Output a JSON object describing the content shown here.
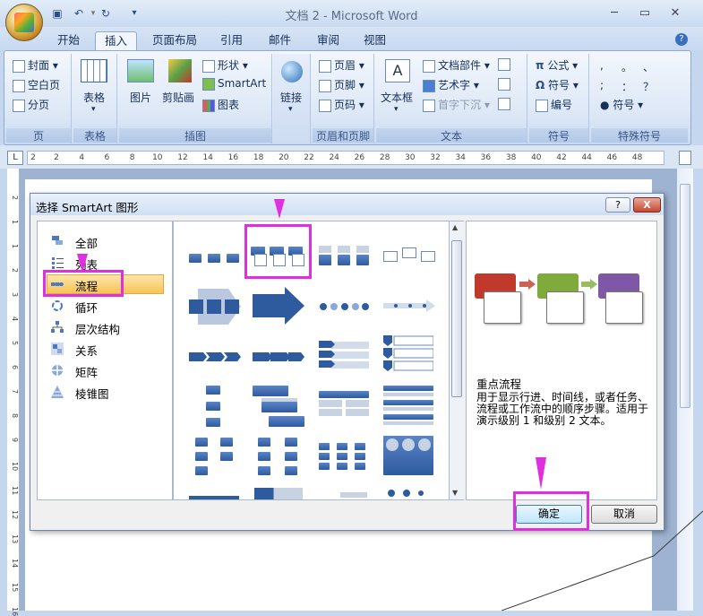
{
  "window": {
    "title": "文档 2 - Microsoft Word"
  },
  "tabs": [
    "开始",
    "插入",
    "页面布局",
    "引用",
    "邮件",
    "审阅",
    "视图"
  ],
  "ribbon": {
    "pages": {
      "label": "页",
      "items": [
        "封面",
        "空白页",
        "分页"
      ]
    },
    "table": {
      "label": "表格",
      "button": "表格"
    },
    "illustrations": {
      "label": "插图",
      "picture": "图片",
      "clipart": "剪贴画",
      "shapes": "形状",
      "smartart": "SmartArt",
      "chart": "图表"
    },
    "links": {
      "button": "链接"
    },
    "header_footer": {
      "label": "页眉和页脚",
      "items": [
        "页眉",
        "页脚",
        "页码"
      ]
    },
    "text": {
      "label": "文本",
      "textbox": "文本框",
      "items": [
        "文档部件",
        "艺术字",
        "首字下沉"
      ]
    },
    "symbols": {
      "label": "符号",
      "items": [
        "公式",
        "符号",
        "编号"
      ]
    },
    "special": {
      "label": "特殊符号",
      "symbol": "符号",
      "chars": [
        ",",
        "。",
        "、",
        ";",
        "：",
        "？"
      ]
    }
  },
  "ruler": {
    "numbers": [
      "2",
      "2",
      "4",
      "6",
      "8",
      "10",
      "12",
      "14",
      "16",
      "18",
      "20",
      "22",
      "24",
      "26",
      "28",
      "30",
      "32",
      "34",
      "36",
      "38",
      "40",
      "42",
      "44",
      "46",
      "48"
    ]
  },
  "vruler": {
    "numbers": [
      "2",
      "1",
      "1",
      "2",
      "3",
      "4",
      "5",
      "6",
      "7",
      "8",
      "9",
      "10",
      "11",
      "12",
      "13",
      "14",
      "15",
      "16"
    ]
  },
  "dialog": {
    "title": "选择 SmartArt 图形",
    "help": "?",
    "close": "X",
    "categories": [
      "全部",
      "列表",
      "流程",
      "循环",
      "层次结构",
      "关系",
      "矩阵",
      "棱锥图"
    ],
    "selected_category": "流程",
    "preview": {
      "title": "重点流程",
      "description": "用于显示行进、时间线，或者任务、流程或工作流中的顺序步骤。适用于演示级别 1 和级别 2 文本。",
      "colors": [
        "#c0392b",
        "#7fab3c",
        "#7e57a6"
      ]
    },
    "ok": "确定",
    "cancel": "取消"
  },
  "accent": {
    "highlight": "#e02fe0",
    "selection": "#f7c357"
  }
}
